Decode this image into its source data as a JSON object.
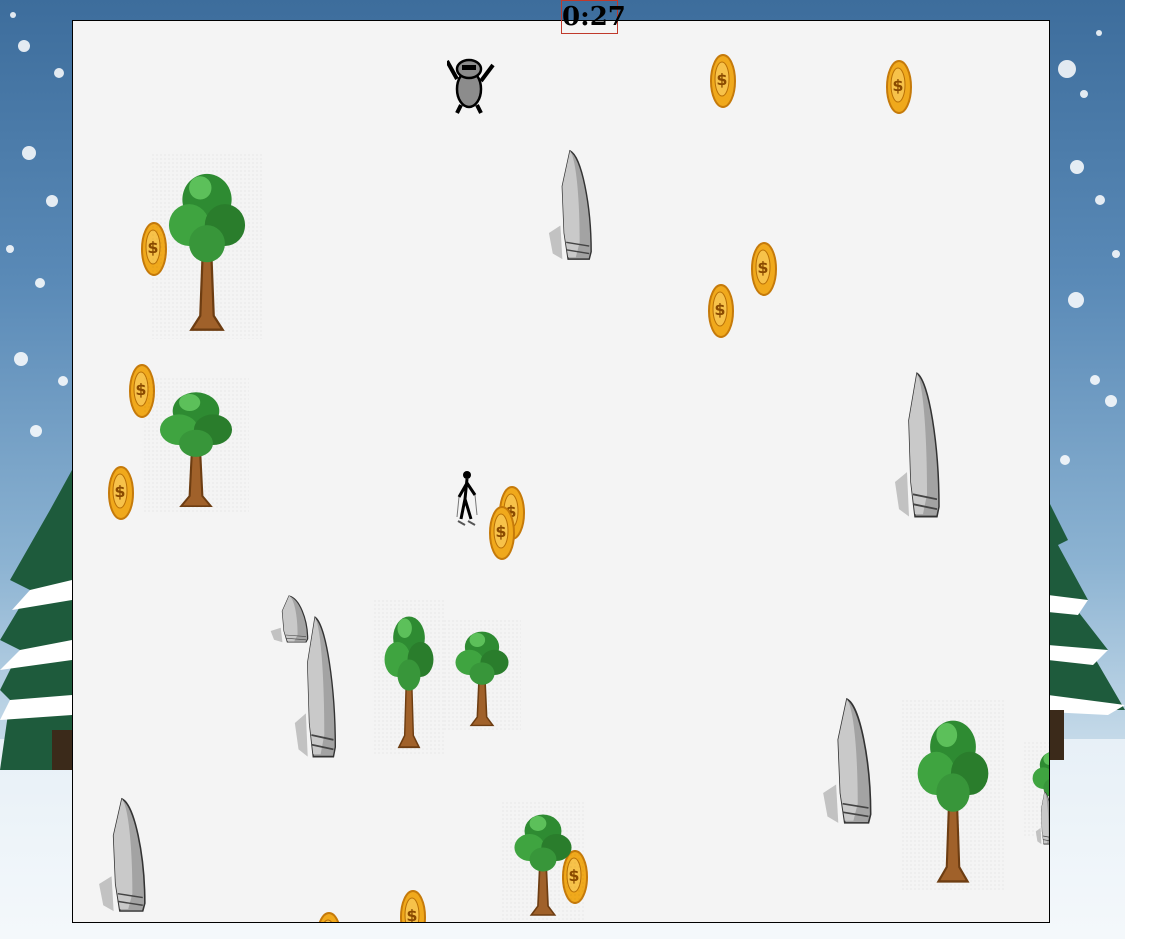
{
  "timer": {
    "text": "0:27"
  },
  "sprites": {
    "coin_icon": "dollar-coin",
    "tree_icon": "green-tree",
    "rock_icon": "grey-rock",
    "yeti_icon": "yeti",
    "skier_icon": "skier"
  },
  "coin_symbol": "$",
  "colors": {
    "field_background": "#f4f4f4",
    "timer_border": "#c0392b",
    "coin_gold": "#f0a91c",
    "tree_green": "#2e8b32",
    "rock_grey": "#9a9a9a"
  }
}
